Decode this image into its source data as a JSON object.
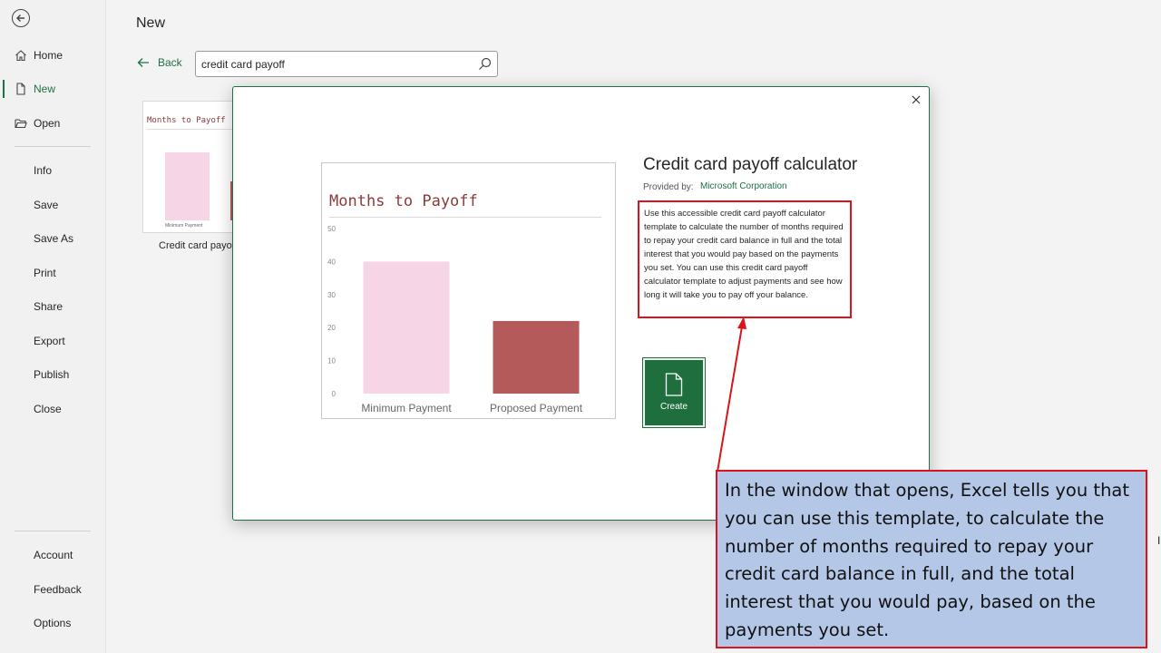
{
  "sidebar": {
    "items": [
      {
        "label": "Home",
        "icon": "home-icon"
      },
      {
        "label": "New",
        "icon": "new-file-icon",
        "active": true
      },
      {
        "label": "Open",
        "icon": "folder-icon"
      },
      {
        "label": "Info"
      },
      {
        "label": "Save"
      },
      {
        "label": "Save As"
      },
      {
        "label": "Print"
      },
      {
        "label": "Share"
      },
      {
        "label": "Export"
      },
      {
        "label": "Publish"
      },
      {
        "label": "Close"
      }
    ],
    "bottom_items": [
      {
        "label": "Account"
      },
      {
        "label": "Feedback"
      },
      {
        "label": "Options"
      }
    ]
  },
  "main": {
    "title": "New",
    "back_label": "Back",
    "search_value": "credit card payoff",
    "template_card": {
      "thumb_title": "Months to Payoff",
      "thumb_label": "Minimum Payment",
      "title": "Credit card payoff"
    }
  },
  "dialog": {
    "title": "Credit card payoff calculator",
    "provided_by_label": "Provided by:",
    "provider": "Microsoft Corporation",
    "description": "Use this accessible credit card payoff calculator template to calculate the number of months required to repay your credit card balance in full and the total interest that you would pay based on the payments you set. You can use this credit card payoff calculator template to adjust payments and see how long it will take you to pay off your balance.",
    "create_label": "Create",
    "preview": {
      "title": "Months to Payoff"
    }
  },
  "chart_data": {
    "type": "bar",
    "title": "Months to Payoff",
    "categories": [
      "Minimum Payment",
      "Proposed Payment"
    ],
    "values": [
      40,
      22
    ],
    "ylim": [
      0,
      50
    ],
    "yticks": [
      0,
      10,
      20,
      30,
      40,
      50
    ],
    "colors": [
      "#f6d6e6",
      "#b45a5a"
    ]
  },
  "callout": {
    "text": "In the window that opens, Excel tells you that you can use this template, to calculate the number of months required to repay your credit card balance in full, and the total interest that you would pay, based on the payments you set."
  },
  "colors": {
    "accent": "#1e7145",
    "highlight_border": "#d9141b",
    "callout_bg": "#b4c7e7"
  }
}
